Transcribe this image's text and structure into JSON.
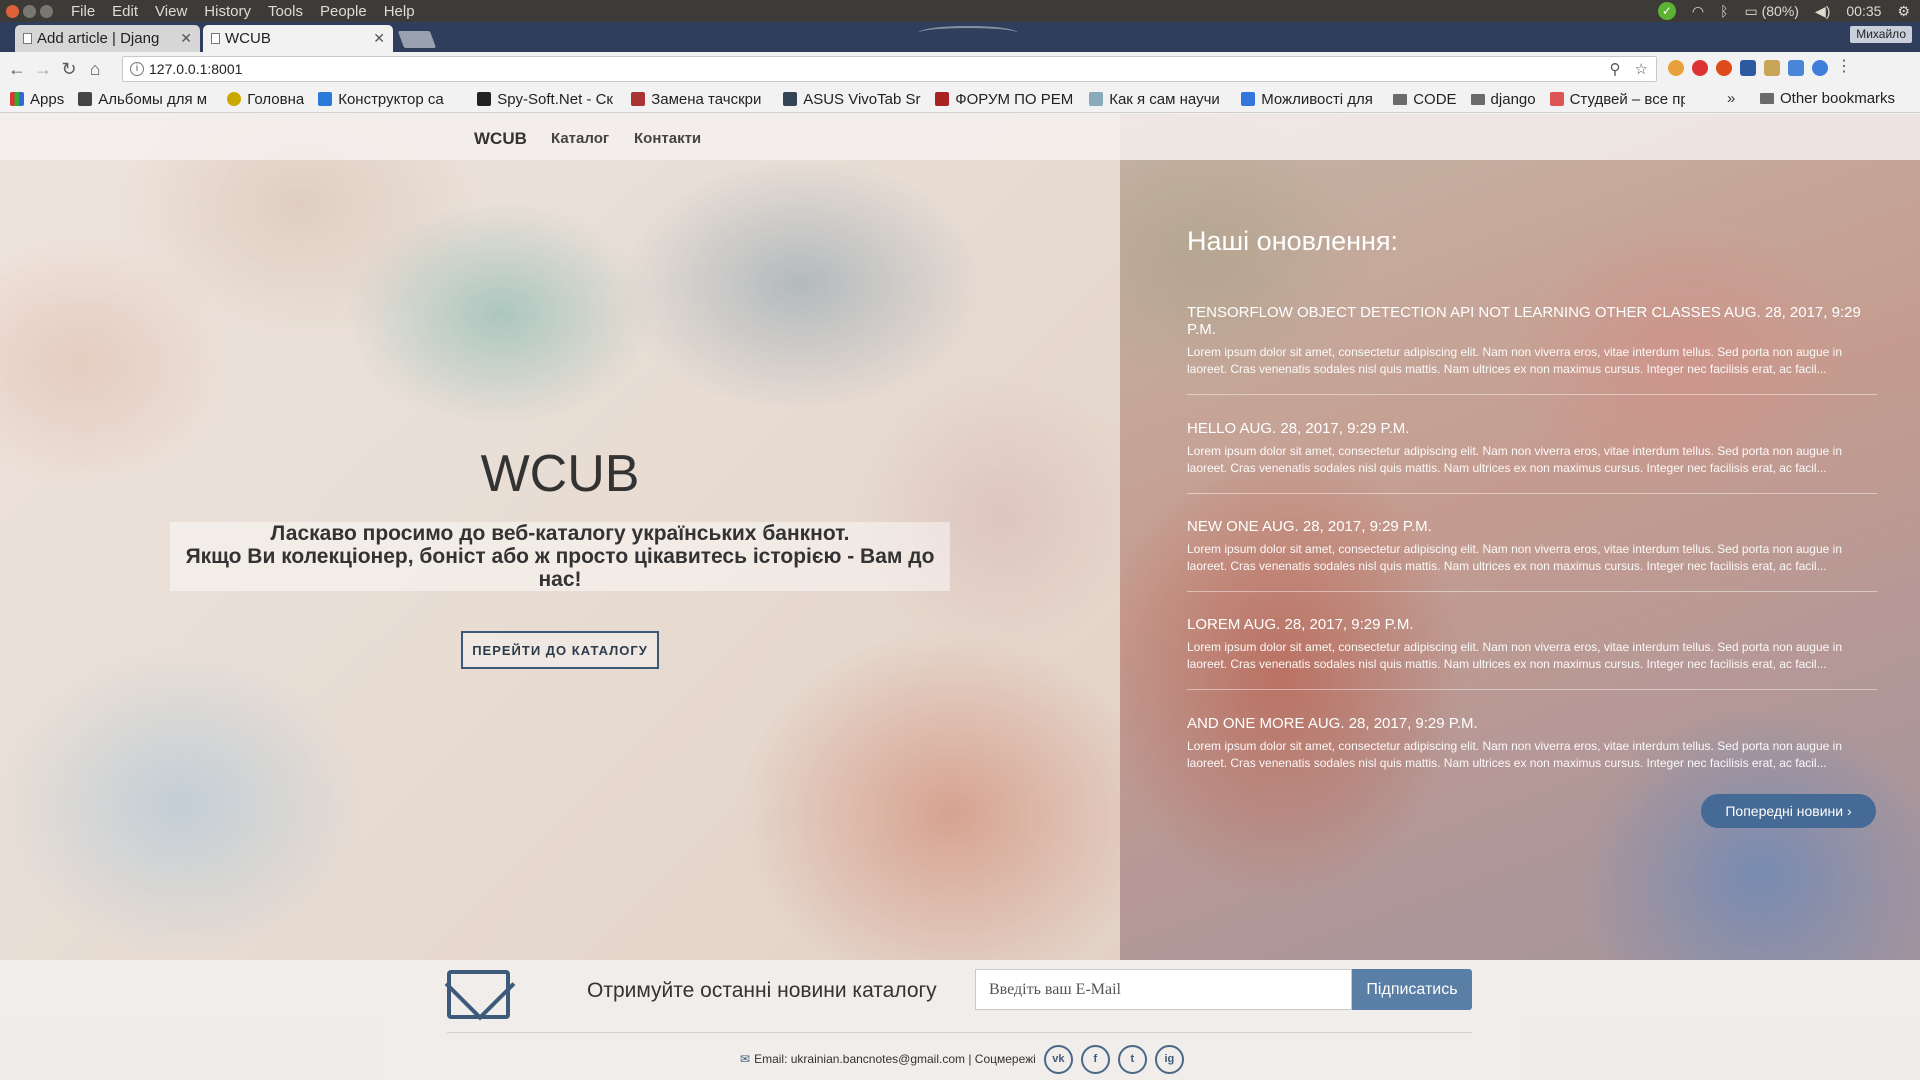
{
  "os": {
    "menu": [
      "File",
      "Edit",
      "View",
      "History",
      "Tools",
      "People",
      "Help"
    ],
    "battery": "(80%)",
    "time": "00:35"
  },
  "browser": {
    "tabs": [
      {
        "title": "Add article | Djang"
      },
      {
        "title": "WCUB"
      }
    ],
    "profile": "Михайло",
    "url": "127.0.0.1:8001",
    "bookmarks": [
      {
        "label": "Apps",
        "color": "#d33"
      },
      {
        "label": "Альбомы для м",
        "color": "#444"
      },
      {
        "label": "Головна",
        "color": "#c9a800"
      },
      {
        "label": "Конструктор са",
        "color": "#2a7ad8"
      },
      {
        "label": "Spy-Soft.Net - Ск",
        "color": "#222"
      },
      {
        "label": "Замена тачскри",
        "color": "#a33"
      },
      {
        "label": "ASUS VivoTab Sr",
        "color": "#345"
      },
      {
        "label": "ФОРУМ ПО РЕМ",
        "color": "#a22"
      },
      {
        "label": "Как я сам научи",
        "color": "#8ab"
      },
      {
        "label": "Можливості для",
        "color": "#37d"
      },
      {
        "label": "CODE",
        "folder": true
      },
      {
        "label": "django",
        "folder": true
      },
      {
        "label": "Студвей – все пр",
        "color": "#d55"
      }
    ],
    "more": "»",
    "other_bookmarks": "Other bookmarks"
  },
  "site": {
    "brand": "WCUB",
    "nav": [
      "Каталог",
      "Контакти"
    ],
    "hero": {
      "title": "WCUB",
      "line1": "Ласкаво просимо до веб-каталогу українських банкнот.",
      "line2": "Якщо Ви колекціонер, боніст або ж просто цікавитесь історією - Вам до нас!",
      "button": "ПЕРЕЙТИ ДО КАТАЛОГУ"
    },
    "news": {
      "heading": "Наші оновлення:",
      "items": [
        {
          "title": "TENSORFLOW OBJECT DETECTION API NOT LEARNING OTHER CLASSES AUG. 28, 2017, 9:29 P.M.",
          "body": "Lorem ipsum dolor sit amet, consectetur adipiscing elit. Nam non viverra eros, vitae interdum tellus. Sed porta non augue in laoreet. Cras venenatis sodales nisl quis mattis. Nam ultrices ex non maximus cursus. Integer nec facilisis erat, ac facil..."
        },
        {
          "title": "HELLO AUG. 28, 2017, 9:29 P.M.",
          "body": "Lorem ipsum dolor sit amet, consectetur adipiscing elit. Nam non viverra eros, vitae interdum tellus. Sed porta non augue in laoreet. Cras venenatis sodales nisl quis mattis. Nam ultrices ex non maximus cursus. Integer nec facilisis erat, ac facil..."
        },
        {
          "title": "NEW ONE AUG. 28, 2017, 9:29 P.M.",
          "body": "Lorem ipsum dolor sit amet, consectetur adipiscing elit. Nam non viverra eros, vitae interdum tellus. Sed porta non augue in laoreet. Cras venenatis sodales nisl quis mattis. Nam ultrices ex non maximus cursus. Integer nec facilisis erat, ac facil..."
        },
        {
          "title": "LOREM AUG. 28, 2017, 9:29 P.M.",
          "body": "Lorem ipsum dolor sit amet, consectetur adipiscing elit. Nam non viverra eros, vitae interdum tellus. Sed porta non augue in laoreet. Cras venenatis sodales nisl quis mattis. Nam ultrices ex non maximus cursus. Integer nec facilisis erat, ac facil..."
        },
        {
          "title": "AND ONE MORE AUG. 28, 2017, 9:29 P.M.",
          "body": "Lorem ipsum dolor sit amet, consectetur adipiscing elit. Nam non viverra eros, vitae interdum tellus. Sed porta non augue in laoreet. Cras venenatis sodales nisl quis mattis. Nam ultrices ex non maximus cursus. Integer nec facilisis erat, ac facil..."
        }
      ],
      "more": "Попередні новини ›"
    },
    "subscribe": {
      "text": "Отримуйте останні новини каталогу",
      "placeholder": "Введіть ваш E-Mail",
      "button": "Підписатись"
    },
    "footer": {
      "email": "Email: ukrainian.bancnotes@gmail.com | Соцмережі",
      "social": [
        "vk",
        "f",
        "t",
        "ig"
      ]
    }
  }
}
